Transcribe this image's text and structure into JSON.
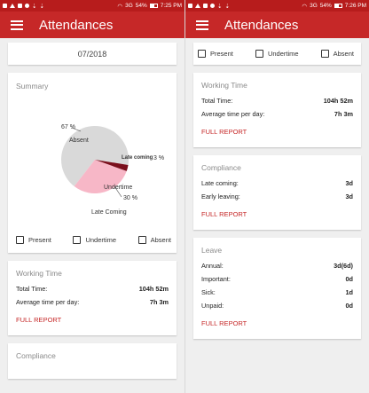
{
  "status_left": {
    "time": "7:25 PM",
    "battery": "54%",
    "network": "3G"
  },
  "status_right": {
    "time": "7:26 PM",
    "battery": "54%",
    "network": "3G"
  },
  "app": {
    "title": "Attendances",
    "accent_color": "#c62828",
    "status_color": "#b71c1c"
  },
  "month": "07/2018",
  "summary": {
    "title": "Summary",
    "labels": {
      "absent_pct": "67 %",
      "absent": "Absent",
      "late_pct": "3 %",
      "late_name": "Late coming",
      "undertime": "Undertime",
      "undertime_pct": "30 %",
      "late_coming": "Late Coming"
    }
  },
  "legend": {
    "present": "Present",
    "undertime": "Undertime",
    "absent": "Absent"
  },
  "working_time": {
    "title": "Working Time",
    "rows": [
      {
        "label": "Total Time:",
        "value": "104h 52m"
      },
      {
        "label": "Average time per day:",
        "value": "7h 3m"
      }
    ],
    "link": "FULL REPORT"
  },
  "compliance": {
    "title": "Compliance",
    "rows": [
      {
        "label": "Late coming:",
        "value": "3d"
      },
      {
        "label": "Early leaving:",
        "value": "3d"
      }
    ],
    "link": "FULL REPORT"
  },
  "leave": {
    "title": "Leave",
    "rows": [
      {
        "label": "Annual:",
        "value": "3d(6d)"
      },
      {
        "label": "Important:",
        "value": "0d"
      },
      {
        "label": "Sick:",
        "value": "1d"
      },
      {
        "label": "Unpaid:",
        "value": "0d"
      }
    ],
    "link": "FULL REPORT"
  },
  "chart_data": {
    "type": "pie",
    "categories": [
      "Absent",
      "Undertime",
      "Late coming"
    ],
    "values": [
      67,
      30,
      3
    ],
    "colors": [
      "#d9d9d9",
      "#f7b7c7",
      "#7a0f1c"
    ],
    "legend": [
      "Present",
      "Undertime",
      "Absent"
    ],
    "legend_placement": "bottom"
  }
}
